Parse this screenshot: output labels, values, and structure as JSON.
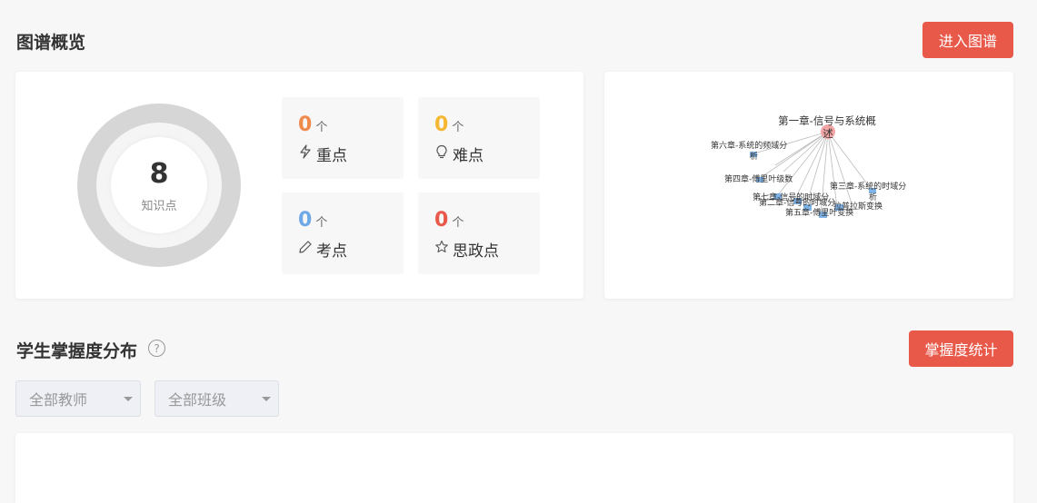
{
  "overview": {
    "title": "图谱概览",
    "enter_button": "进入图谱",
    "total_count": "8",
    "total_label": "知识点",
    "stats": [
      {
        "value": "0",
        "unit": "个",
        "label": "重点",
        "color": "#f08a4b",
        "icon": "lightning-icon"
      },
      {
        "value": "0",
        "unit": "个",
        "label": "难点",
        "color": "#f5b731",
        "icon": "bulb-icon"
      },
      {
        "value": "0",
        "unit": "个",
        "label": "考点",
        "color": "#6fa8e6",
        "icon": "pencil-icon"
      },
      {
        "value": "0",
        "unit": "个",
        "label": "思政点",
        "color": "#e8594a",
        "icon": "star-icon"
      }
    ],
    "graph": {
      "center_line1": "第一章-信号与系统概",
      "center_line2": "述",
      "nodes": [
        "第六章-系统的频域分",
        "析",
        "第四章-傅里叶级数",
        "第三章-系统的时域分",
        "析",
        "第七章-信号的时域分",
        "第二章-信号的时域分",
        "第五章-傅里叶变换",
        "拉普拉斯变换"
      ]
    }
  },
  "mastery": {
    "title": "学生掌握度分布",
    "help_icon": "question-circle-icon",
    "stats_button": "掌握度统计",
    "teacher_select": "全部教师",
    "class_select": "全部班级"
  },
  "colors": {
    "accent": "#e8594a",
    "ring": "#d6d6d6",
    "graph_center": "#f4a6a6",
    "graph_node": "#7fb2e5"
  }
}
